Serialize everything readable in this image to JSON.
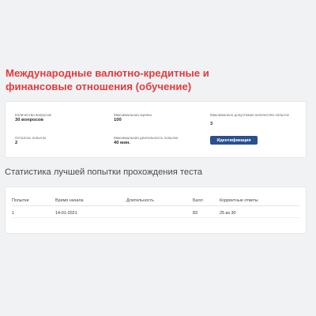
{
  "page": {
    "title": "Международные валютно-кредитные и финансовые отношения (обучение)"
  },
  "info": {
    "questions_label": "Количество вопросов",
    "questions_value": "30 вопросов",
    "max_score_label": "Максимальная оценка",
    "max_score_value": "100",
    "max_attempts_label": "Максимально допустимое количество попыток",
    "max_attempts_value": "3",
    "remaining_label": "Осталось попыток",
    "remaining_value": "2",
    "max_duration_label": "Максимальная длительность попытки",
    "max_duration_value": "40 мин.",
    "ident_button": "Идентификация"
  },
  "stats": {
    "title": "Статистика лучшей попытки прохождения теста",
    "columns": [
      "Попытки",
      "Время начала",
      "Длительность",
      "Балл",
      "Корректные ответы"
    ],
    "rows": [
      [
        "1",
        "14-01-2021",
        "",
        "83",
        "25 из 30"
      ]
    ]
  },
  "colors": {
    "accent": "#e33a3d",
    "button": "#2a4f8f",
    "background": "#f1f2f4"
  }
}
